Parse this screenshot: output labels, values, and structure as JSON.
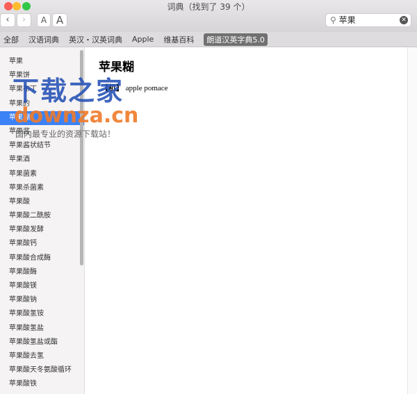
{
  "window": {
    "title": "词典（找到了 39 个）",
    "traffic_colors": [
      "#fc5f57",
      "#fdbc2e",
      "#33c748"
    ]
  },
  "toolbar": {
    "back": "‹",
    "forward": "›",
    "font_smaller": "A",
    "font_larger": "A",
    "search_value": "苹果",
    "search_icon": "magnifier-icon",
    "clear_icon": "✕"
  },
  "tabs": [
    "全部",
    "汉语词典",
    "英汉・汉英词典",
    "Apple",
    "维基百科",
    "朗道汉英字典5.0"
  ],
  "selected_tab": 5,
  "sidebar": {
    "items": [
      "苹果",
      "苹果饼",
      "苹果布丁",
      "苹果的",
      "苹果糊",
      "苹果酱",
      "苹果酱状结节",
      "苹果酒",
      "苹果菌素",
      "苹果杀菌素",
      "苹果酸",
      "苹果酸二酰胺",
      "苹果酸发酵",
      "苹果酸钙",
      "苹果酸合成酶",
      "苹果酸酶",
      "苹果酸镁",
      "苹果酸钠",
      "苹果酸氢铵",
      "苹果酸氢盐",
      "苹果酸氢盐或酯",
      "苹果酸去氢",
      "苹果酸天冬氨酸循环",
      "苹果酸铁"
    ],
    "selected": 4
  },
  "entry": {
    "headword": "苹果糊",
    "tag": "【机】",
    "definition": "apple pomace"
  },
  "watermark": {
    "line1": "下载之家",
    "line2": "downza.cn",
    "line3": "国内最专业的资源下载站！"
  }
}
